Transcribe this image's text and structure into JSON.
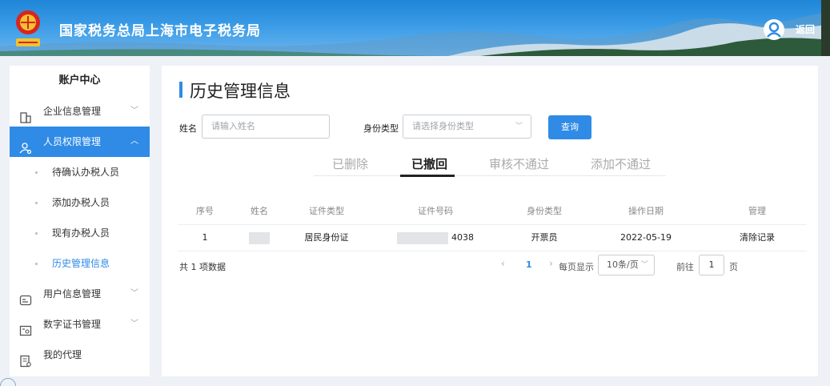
{
  "header": {
    "title": "国家税务总局上海市电子税务局",
    "back_label": "返回",
    "logo_icon": "tax-emblem-icon",
    "user_icon": "user-avatar-icon"
  },
  "sidebar": {
    "title": "账户中心",
    "items": [
      {
        "label": "企业信息管理",
        "icon": "building-icon",
        "expanded": false
      },
      {
        "label": "人员权限管理",
        "icon": "user-lock-icon",
        "expanded": true,
        "active": true
      },
      {
        "label": "用户信息管理",
        "icon": "id-card-icon",
        "expanded": false
      },
      {
        "label": "数字证书管理",
        "icon": "certificate-icon",
        "expanded": false
      },
      {
        "label": "我的代理",
        "icon": "document-icon"
      }
    ],
    "subitems": [
      {
        "label": "待确认办税人员"
      },
      {
        "label": "添加办税人员"
      },
      {
        "label": "现有办税人员"
      },
      {
        "label": "历史管理信息",
        "current": true
      }
    ]
  },
  "main": {
    "title": "历史管理信息",
    "search": {
      "name_label": "姓名",
      "name_placeholder": "请输入姓名",
      "type_label": "身份类型",
      "type_placeholder": "请选择身份类型",
      "query_label": "查询"
    },
    "tabs": [
      {
        "label": "已删除"
      },
      {
        "label": "已撤回",
        "active": true
      },
      {
        "label": "审核不通过"
      },
      {
        "label": "添加不通过"
      }
    ],
    "table": {
      "headers": [
        "序号",
        "姓名",
        "证件类型",
        "证件号码",
        "身份类型",
        "操作日期",
        "管理"
      ],
      "rows": [
        {
          "index": "1",
          "name": "",
          "id_type": "居民身份证",
          "id_number": "4038",
          "role": "开票员",
          "date": "2022-05-19",
          "action": "清除记录"
        }
      ]
    },
    "pagination": {
      "total": "共 1 项数据",
      "current_page": "1",
      "per_page_label": "每页显示",
      "per_page_value": "10条/页",
      "goto_label": "前往",
      "goto_value": "1",
      "page_suffix": "页"
    }
  },
  "colors": {
    "accent": "#2f8be6",
    "header_top": "#1f86d8",
    "page_bg": "#eef2f7"
  }
}
